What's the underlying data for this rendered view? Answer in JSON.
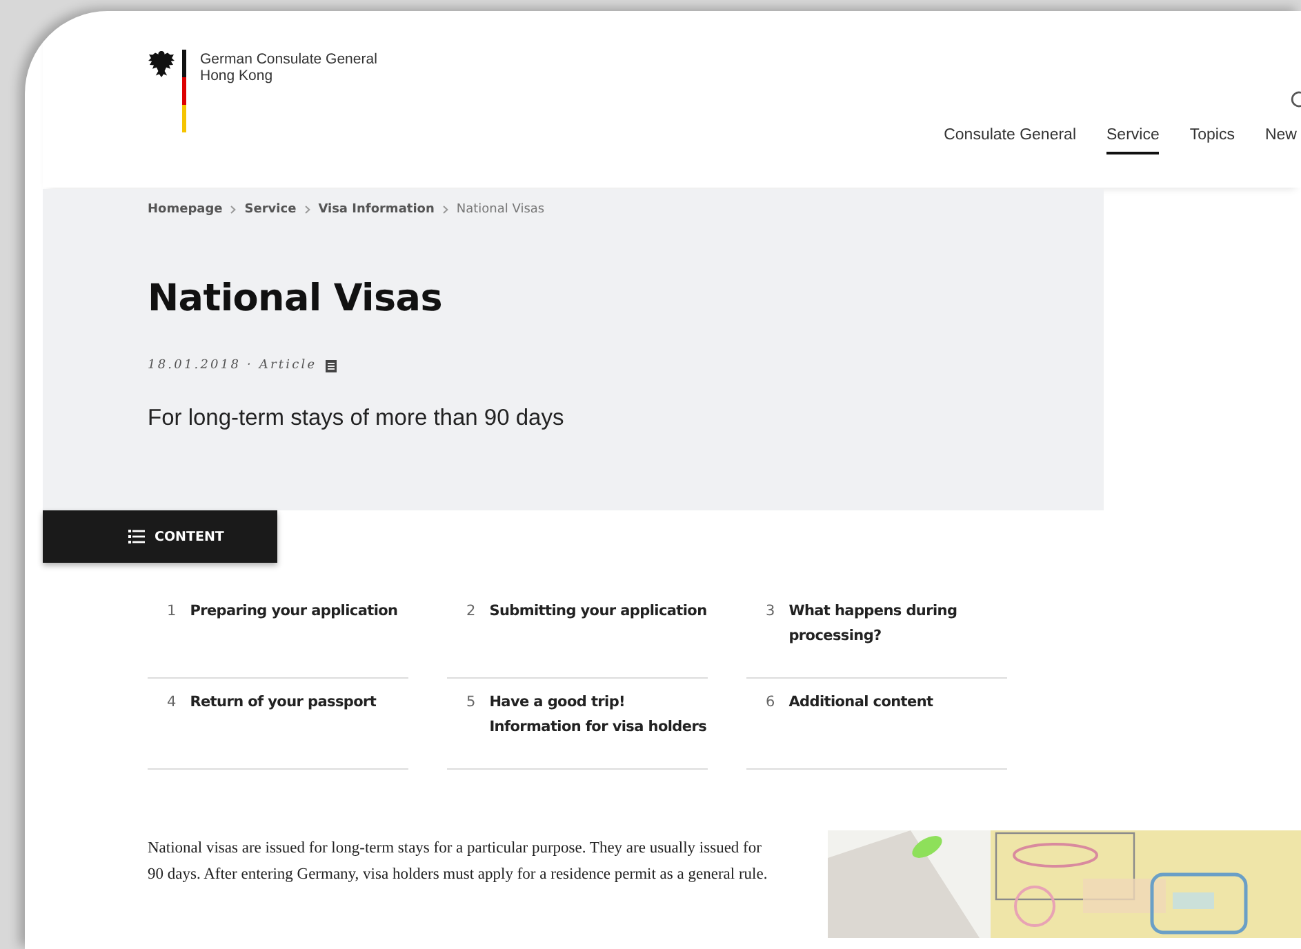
{
  "header": {
    "org_name": "German Consulate General",
    "org_city": "Hong Kong"
  },
  "nav": [
    {
      "label": "Consulate General",
      "selected": false
    },
    {
      "label": "Service",
      "selected": true
    },
    {
      "label": "Topics",
      "selected": false
    },
    {
      "label": "New",
      "selected": false
    }
  ],
  "breadcrumb": [
    {
      "label": "Homepage",
      "kind": "link"
    },
    {
      "label": "Service",
      "kind": "link"
    },
    {
      "label": "Visa Information",
      "kind": "link"
    },
    {
      "label": "National Visas",
      "kind": "current"
    }
  ],
  "title": "National Visas",
  "meta": "18.01.2018 · Article",
  "subtitle": "For long-term stays of more than 90 days",
  "content_button": "CONTENT",
  "toc": [
    {
      "number": "1",
      "lines": [
        "Preparing your application"
      ]
    },
    {
      "number": "2",
      "lines": [
        "Submitting your application"
      ]
    },
    {
      "number": "3",
      "lines": [
        "What happens during",
        "processing?"
      ]
    },
    {
      "number": "4",
      "lines": [
        "Return of your passport"
      ]
    },
    {
      "number": "5",
      "lines": [
        "Have a good trip!",
        "Information for visa holders"
      ]
    },
    {
      "number": "6",
      "lines": [
        "Additional content"
      ]
    }
  ],
  "intro": "National visas are issued for long-term stays for a particular purpose. They are usually issued for 90 days. After entering Germany, visa holders must apply for a residence permit as a general rule."
}
